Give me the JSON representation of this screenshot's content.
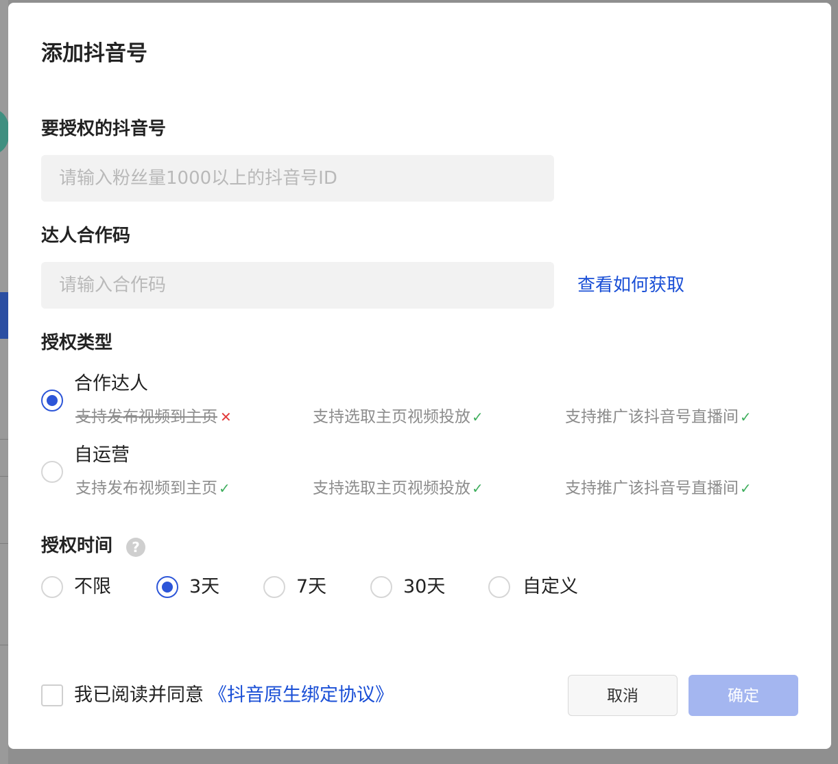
{
  "dialog": {
    "title": "添加抖音号"
  },
  "account": {
    "label": "要授权的抖音号",
    "placeholder": "请输入粉丝量1000以上的抖音号ID",
    "value": ""
  },
  "coop_code": {
    "label": "达人合作码",
    "placeholder": "请输入合作码",
    "value": "",
    "help_link": "查看如何获取"
  },
  "auth_type": {
    "label": "授权类型",
    "selected": "合作达人",
    "options": [
      {
        "label": "合作达人",
        "features": [
          {
            "text": "支持发布视频到主页",
            "supported": false
          },
          {
            "text": "支持选取主页视频投放",
            "supported": true
          },
          {
            "text": "支持推广该抖音号直播间",
            "supported": true
          }
        ]
      },
      {
        "label": "自运营",
        "features": [
          {
            "text": "支持发布视频到主页",
            "supported": true
          },
          {
            "text": "支持选取主页视频投放",
            "supported": true
          },
          {
            "text": "支持推广该抖音号直播间",
            "supported": true
          }
        ]
      }
    ]
  },
  "auth_time": {
    "label": "授权时间",
    "help_icon": "question-circle-icon",
    "selected": "3天",
    "options": [
      "不限",
      "3天",
      "7天",
      "30天",
      "自定义"
    ]
  },
  "agreement": {
    "checked": false,
    "text": "我已阅读并同意",
    "link": "《抖音原生绑定协议》"
  },
  "buttons": {
    "cancel": "取消",
    "confirm": "确定"
  },
  "colors": {
    "accent": "#2c55d8",
    "link": "#1a4fd6",
    "confirm_disabled": "#a4b6f0",
    "ok_mark": "#3fae5d",
    "no_mark": "#e23b3b"
  }
}
